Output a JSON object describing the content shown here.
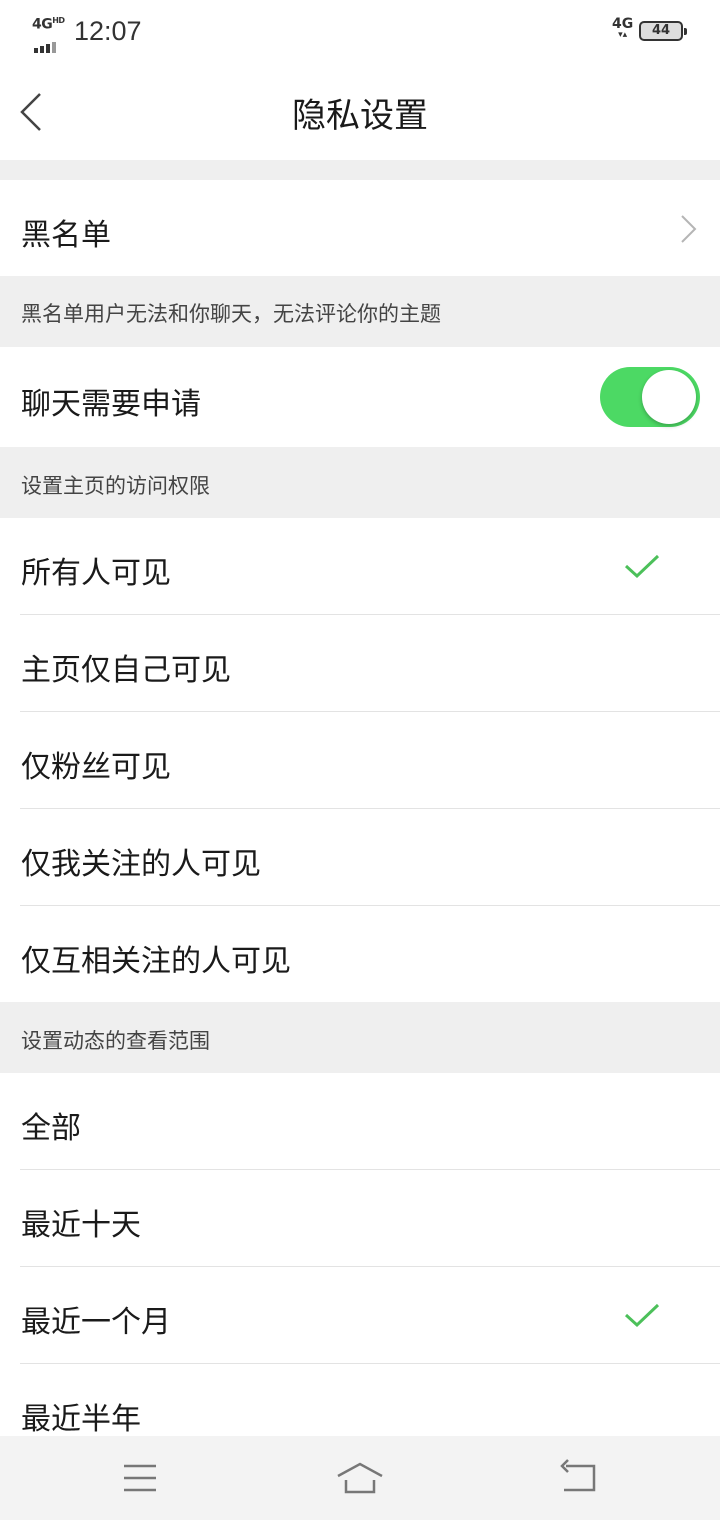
{
  "status_bar": {
    "network": "4G",
    "network_hd": "HD",
    "time": "12:07",
    "mobile_data": "4G",
    "battery": "44"
  },
  "header": {
    "title": "隐私设置",
    "back_icon": "chevron-left-icon"
  },
  "blacklist": {
    "label": "黑名单",
    "hint": "黑名单用户无法和你聊天，无法评论你的主题"
  },
  "chat_request": {
    "label": "聊天需要申请",
    "enabled": true,
    "color_on": "#4cd964"
  },
  "homepage_access": {
    "header": "设置主页的访问权限",
    "options": [
      {
        "label": "所有人可见",
        "selected": true
      },
      {
        "label": "主页仅自己可见",
        "selected": false
      },
      {
        "label": "仅粉丝可见",
        "selected": false
      },
      {
        "label": "仅我关注的人可见",
        "selected": false
      },
      {
        "label": "仅互相关注的人可见",
        "selected": false
      }
    ]
  },
  "feed_range": {
    "header": "设置动态的查看范围",
    "options": [
      {
        "label": "全部",
        "selected": false
      },
      {
        "label": "最近十天",
        "selected": false
      },
      {
        "label": "最近一个月",
        "selected": true
      },
      {
        "label": "最近半年",
        "selected": false
      }
    ]
  },
  "check_color": "#4cc05a",
  "nav_bar": {
    "menu_icon": "menu-icon",
    "home_icon": "home-icon",
    "back_icon": "back-icon"
  }
}
